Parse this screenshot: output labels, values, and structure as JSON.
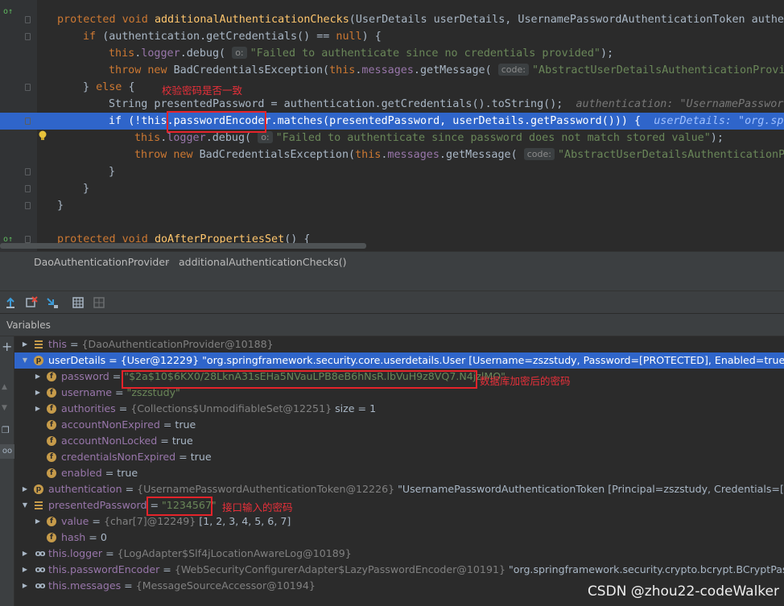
{
  "editor": {
    "lines": [
      {
        "indent": 0,
        "parts": [
          [
            "kw",
            "protected "
          ],
          [
            "kw",
            "void "
          ],
          [
            "fn",
            "additionalAuthenticationChecks"
          ],
          [
            "",
            "(UserDetails userDetails, UsernamePasswordAuthenticationToken authen"
          ]
        ]
      },
      {
        "indent": 1,
        "parts": [
          [
            "kw",
            "if "
          ],
          [
            "",
            "(authentication.getCredentials() == "
          ],
          [
            "kw",
            "null"
          ],
          [
            "",
            ") {"
          ]
        ]
      },
      {
        "indent": 2,
        "parts": [
          [
            "kw",
            "this"
          ],
          [
            "",
            "."
          ],
          [
            "fld",
            "logger"
          ],
          [
            "",
            ".debug( "
          ],
          [
            "hint",
            "o:"
          ],
          [
            "str",
            "\"Failed to authenticate since no credentials provided\""
          ],
          [
            "",
            ");"
          ]
        ]
      },
      {
        "indent": 2,
        "parts": [
          [
            "kw",
            "throw new "
          ],
          [
            "",
            "BadCredentialsException("
          ],
          [
            "kw",
            "this"
          ],
          [
            "",
            "."
          ],
          [
            "fld",
            "messages"
          ],
          [
            "",
            ".getMessage( "
          ],
          [
            "hint",
            "code:"
          ],
          [
            "str",
            "\"AbstractUserDetailsAuthenticationProvid"
          ]
        ]
      },
      {
        "indent": 1,
        "parts": [
          [
            "",
            "} "
          ],
          [
            "kw",
            "else "
          ],
          [
            "",
            "{"
          ]
        ]
      },
      {
        "indent": 2,
        "parts": [
          [
            "",
            "String presentedPassword = authentication.getCredentials().toString();  "
          ],
          [
            "inlay",
            "authentication: \"UsernamePasswor"
          ]
        ]
      },
      {
        "indent": 2,
        "hl": true,
        "parts": [
          [
            "kw",
            "if "
          ],
          [
            "",
            "(!"
          ],
          [
            "kw",
            "this"
          ],
          [
            "",
            "."
          ],
          [
            "fld",
            "passwordEncoder"
          ],
          [
            "",
            ".matches(presentedPassword, userDetails.getPassword())) {  "
          ],
          [
            "inlay",
            "userDetails: \"org.sp"
          ]
        ]
      },
      {
        "indent": 3,
        "parts": [
          [
            "kw",
            "this"
          ],
          [
            "",
            "."
          ],
          [
            "fld",
            "logger"
          ],
          [
            "",
            ".debug( "
          ],
          [
            "hint",
            "o:"
          ],
          [
            "str",
            "\"Failed to authenticate since password does not match stored value\""
          ],
          [
            "",
            ");"
          ]
        ]
      },
      {
        "indent": 3,
        "parts": [
          [
            "kw",
            "throw new "
          ],
          [
            "",
            "BadCredentialsException("
          ],
          [
            "kw",
            "this"
          ],
          [
            "",
            "."
          ],
          [
            "fld",
            "messages"
          ],
          [
            "",
            ".getMessage( "
          ],
          [
            "hint",
            "code:"
          ],
          [
            "str",
            "\"AbstractUserDetailsAuthenticationPr"
          ]
        ]
      },
      {
        "indent": 2,
        "parts": [
          [
            "",
            "}"
          ]
        ]
      },
      {
        "indent": 1,
        "parts": [
          [
            "",
            "}"
          ]
        ]
      },
      {
        "indent": 0,
        "parts": [
          [
            "",
            "}"
          ]
        ]
      },
      {
        "indent": 0,
        "parts": [
          [
            "",
            ""
          ]
        ]
      },
      {
        "indent": 0,
        "parts": [
          [
            "kw",
            "protected "
          ],
          [
            "kw",
            "void "
          ],
          [
            "fn",
            "doAfterPropertiesSet"
          ],
          [
            "",
            "() {"
          ]
        ]
      }
    ]
  },
  "breadcrumb": {
    "class_name": "DaoAuthenticationProvider",
    "method_name": "additionalAuthenticationChecks()"
  },
  "variables_panel": {
    "title": "Variables",
    "rows": [
      {
        "depth": 0,
        "arrow": "right",
        "icon": "list",
        "name": "this",
        "eq": " = ",
        "type": "{DaoAuthenticationProvider@10188}",
        "value": ""
      },
      {
        "depth": 0,
        "arrow": "down",
        "icon": "p",
        "name": "userDetails",
        "eq": " = ",
        "type": "{User@12229}",
        "value": " \"org.springframework.security.core.userdetails.User [Username=zszstudy, Password=[PROTECTED], Enabled=true, AccountNon",
        "selected": true
      },
      {
        "depth": 1,
        "arrow": "right",
        "icon": "f",
        "name": "password",
        "eq": " = ",
        "type": "",
        "value": "",
        "str": "\"$2a$10$6KX0/28LknA31sEHa5NVauLPB8eB6hNsR.lbVuH9z8VQ7.N4jzlMO\""
      },
      {
        "depth": 1,
        "arrow": "right",
        "icon": "f",
        "name": "username",
        "eq": " = ",
        "type": "",
        "value": "",
        "str": "\"zszstudy\""
      },
      {
        "depth": 1,
        "arrow": "right",
        "icon": "f",
        "name": "authorities",
        "eq": " = ",
        "type": "{Collections$UnmodifiableSet@12251}",
        "value": "  size = 1"
      },
      {
        "depth": 1,
        "arrow": "",
        "icon": "f",
        "name": "accountNonExpired",
        "eq": " = ",
        "type": "",
        "value": "true"
      },
      {
        "depth": 1,
        "arrow": "",
        "icon": "f",
        "name": "accountNonLocked",
        "eq": " = ",
        "type": "",
        "value": "true"
      },
      {
        "depth": 1,
        "arrow": "",
        "icon": "f",
        "name": "credentialsNonExpired",
        "eq": " = ",
        "type": "",
        "value": "true"
      },
      {
        "depth": 1,
        "arrow": "",
        "icon": "f",
        "name": "enabled",
        "eq": " = ",
        "type": "",
        "value": "true"
      },
      {
        "depth": 0,
        "arrow": "right",
        "icon": "p",
        "name": "authentication",
        "eq": " = ",
        "type": "{UsernamePasswordAuthenticationToken@12226}",
        "value": " \"UsernamePasswordAuthenticationToken [Principal=zszstudy, Credentials=[PROTECTED],"
      },
      {
        "depth": 0,
        "arrow": "down",
        "icon": "list",
        "name": "presentedPassword",
        "eq": " = ",
        "type": "",
        "value": "",
        "str": "\"1234567\""
      },
      {
        "depth": 1,
        "arrow": "right",
        "icon": "f",
        "name": "value",
        "eq": " = ",
        "type": "{char[7]@12249}",
        "value": " [1, 2, 3, 4, 5, 6, 7]"
      },
      {
        "depth": 1,
        "arrow": "",
        "icon": "f",
        "name": "hash",
        "eq": " = ",
        "type": "",
        "value": "0"
      },
      {
        "depth": 0,
        "arrow": "right",
        "icon": "oo",
        "name": "this.logger",
        "eq": " = ",
        "type": "{LogAdapter$Slf4jLocationAwareLog@10189}",
        "value": ""
      },
      {
        "depth": 0,
        "arrow": "right",
        "icon": "oo",
        "name": "this.passwordEncoder",
        "eq": " = ",
        "type": "{WebSecurityConfigurerAdapter$LazyPasswordEncoder@10191}",
        "value": " \"org.springframework.security.crypto.bcrypt.BCryptPasswordEncoder"
      },
      {
        "depth": 0,
        "arrow": "right",
        "icon": "oo",
        "name": "this.messages",
        "eq": " = ",
        "type": "{MessageSourceAccessor@10194}",
        "value": ""
      }
    ]
  },
  "annotations": {
    "verify": "校验密码是否一致",
    "db_password": "数据库加密后的密码",
    "input_password": "接口输入的密码"
  },
  "watermark": "CSDN @zhou22-codeWalker",
  "colors": {
    "selection": "#2f65ca",
    "annotation": "#e5232a",
    "background": "#2b2b2b"
  }
}
